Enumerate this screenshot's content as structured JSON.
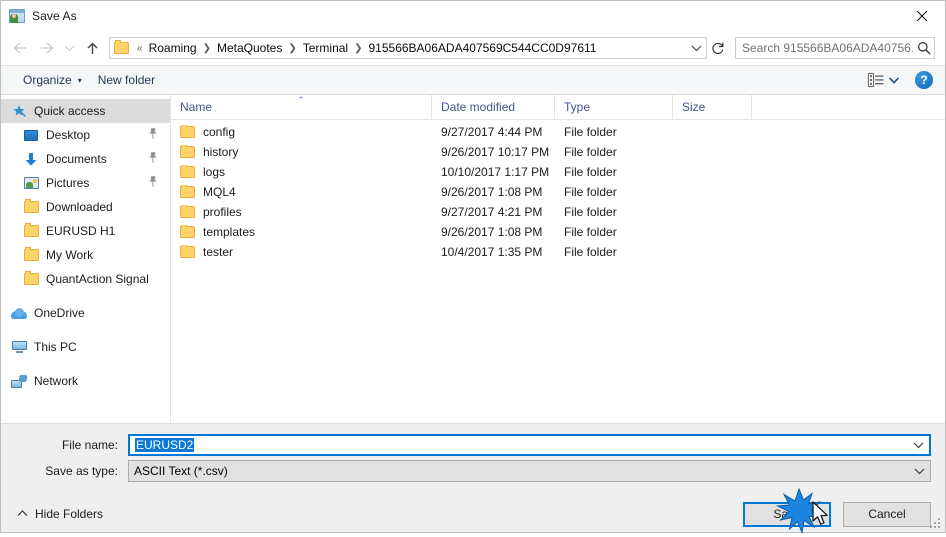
{
  "window": {
    "title": "Save As",
    "icon": "save-as-app-icon",
    "close_label": "✕"
  },
  "nav": {
    "back_icon": "arrow-left-icon",
    "forward_icon": "arrow-right-icon",
    "recent_icon": "chevron-down-icon",
    "up_icon": "arrow-up-icon",
    "refresh_icon": "refresh-icon",
    "overflow": "«",
    "separator": "❯",
    "breadcrumbs": [
      {
        "label": "Roaming"
      },
      {
        "label": "MetaQuotes"
      },
      {
        "label": "Terminal"
      },
      {
        "label": "915566BA06ADA407569C544CC0D97611"
      }
    ],
    "dropdown_icon": "chevron-down-icon"
  },
  "search": {
    "placeholder": "Search 915566BA06ADA40756…",
    "icon": "search-icon"
  },
  "toolbar": {
    "organize_label": "Organize",
    "organize_caret": "▾",
    "new_folder_label": "New folder",
    "view_icon": "list-view-icon",
    "view_caret": "▾",
    "help_label": "?",
    "help_icon": "help-icon"
  },
  "sidebar": {
    "items": [
      {
        "label": "Quick access",
        "icon": "star-pin-icon",
        "selected": true,
        "root": true,
        "pinned": false
      },
      {
        "label": "Desktop",
        "icon": "desktop-icon",
        "selected": false,
        "root": false,
        "pinned": true
      },
      {
        "label": "Documents",
        "icon": "documents-icon",
        "selected": false,
        "root": false,
        "pinned": true
      },
      {
        "label": "Pictures",
        "icon": "pictures-icon",
        "selected": false,
        "root": false,
        "pinned": true
      },
      {
        "label": "Downloaded",
        "icon": "folder-icon",
        "selected": false,
        "root": false,
        "pinned": false
      },
      {
        "label": "EURUSD H1",
        "icon": "folder-icon",
        "selected": false,
        "root": false,
        "pinned": false
      },
      {
        "label": "My Work",
        "icon": "folder-icon",
        "selected": false,
        "root": false,
        "pinned": false
      },
      {
        "label": "QuantAction Signal",
        "icon": "folder-icon",
        "selected": false,
        "root": false,
        "pinned": false
      }
    ],
    "roots": [
      {
        "label": "OneDrive",
        "icon": "onedrive-cloud-icon"
      },
      {
        "label": "This PC",
        "icon": "this-pc-icon"
      },
      {
        "label": "Network",
        "icon": "network-icon"
      }
    ],
    "pin_glyph": "📌"
  },
  "filelist": {
    "columns": {
      "name": "Name",
      "date_modified": "Date modified",
      "type": "Type",
      "size": "Size"
    },
    "sort_caret": "⌃",
    "rows": [
      {
        "name": "config",
        "date": "9/27/2017 4:44 PM",
        "type": "File folder",
        "size": ""
      },
      {
        "name": "history",
        "date": "9/26/2017 10:17 PM",
        "type": "File folder",
        "size": ""
      },
      {
        "name": "logs",
        "date": "10/10/2017 1:17 PM",
        "type": "File folder",
        "size": ""
      },
      {
        "name": "MQL4",
        "date": "9/26/2017 1:08 PM",
        "type": "File folder",
        "size": ""
      },
      {
        "name": "profiles",
        "date": "9/27/2017 4:21 PM",
        "type": "File folder",
        "size": ""
      },
      {
        "name": "templates",
        "date": "9/26/2017 1:08 PM",
        "type": "File folder",
        "size": ""
      },
      {
        "name": "tester",
        "date": "10/4/2017 1:35 PM",
        "type": "File folder",
        "size": ""
      }
    ]
  },
  "form": {
    "file_name_label": "File name:",
    "file_name_value": "EURUSD2",
    "file_name_selected": true,
    "save_as_type_label": "Save as type:",
    "save_as_type_value": "ASCII Text (*.csv)",
    "dropdown_icon": "chevron-down-icon"
  },
  "footer": {
    "hide_folders_label": "Hide Folders",
    "hide_folders_caret": "⌃",
    "save_label": "Save",
    "cancel_label": "Cancel"
  },
  "colors": {
    "accent": "#0078d7",
    "selection": "#0b7ad6",
    "folder": "#fdd36a",
    "header_text": "#41588c",
    "sidebar_selected": "#dcdcdc",
    "footer_bg": "#efefef"
  },
  "cursor": {
    "icon": "mouse-pointer-icon",
    "click_effect": "click-burst"
  }
}
